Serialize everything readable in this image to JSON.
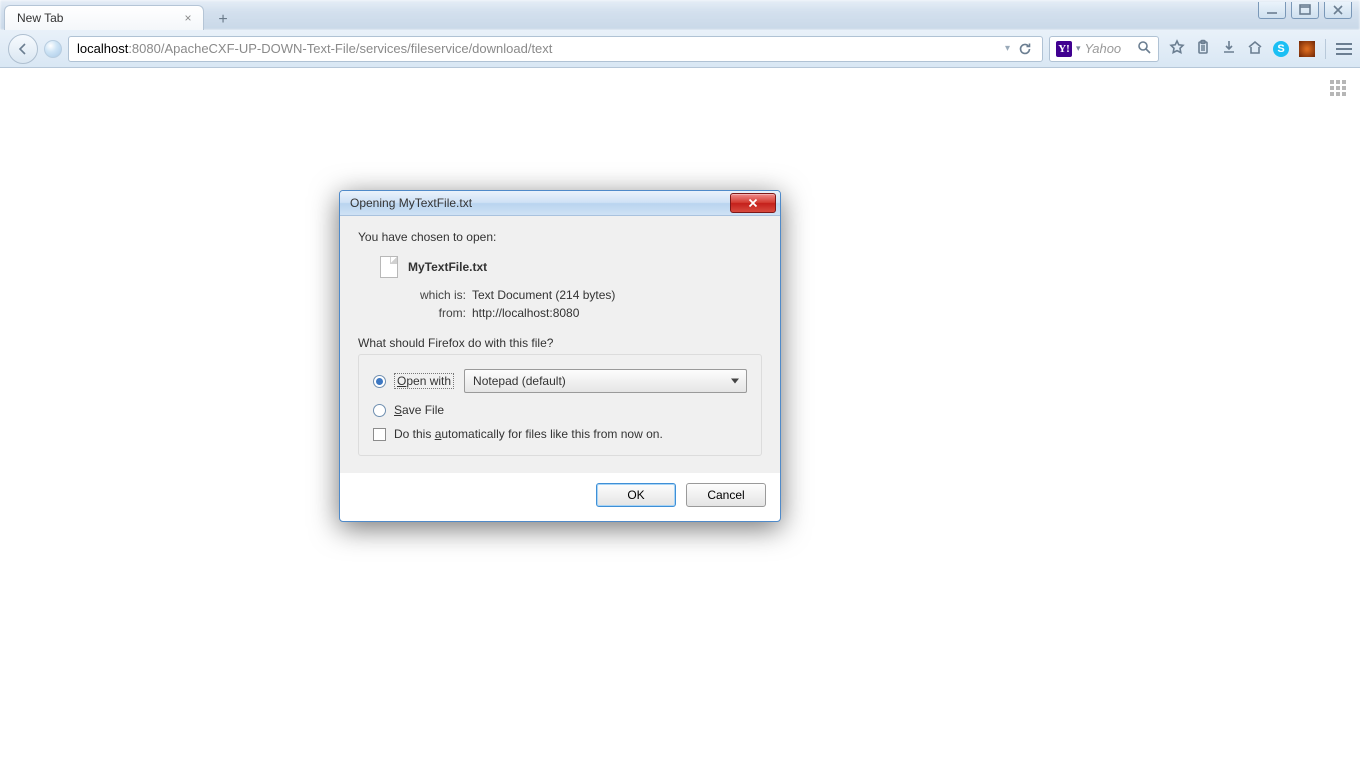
{
  "tab": {
    "title": "New Tab"
  },
  "nav": {
    "url_host": "localhost",
    "url_path": ":8080/ApacheCXF-UP-DOWN-Text-File/services/fileservice/download/text",
    "search_placeholder": "Yahoo",
    "search_badge": "Y!"
  },
  "dialog": {
    "title": "Opening MyTextFile.txt",
    "lead": "You have chosen to open:",
    "file_name": "MyTextFile.txt",
    "which_is_label": "which is:",
    "which_is_value": "Text Document (214 bytes)",
    "from_label": "from:",
    "from_value": "http://localhost:8080",
    "question": "What should Firefox do with this file?",
    "open_with": "Open with",
    "open_with_value": "Notepad (default)",
    "save_file": "Save File",
    "remember": "Do this automatically for files like this from now on.",
    "ok": "OK",
    "cancel": "Cancel"
  }
}
